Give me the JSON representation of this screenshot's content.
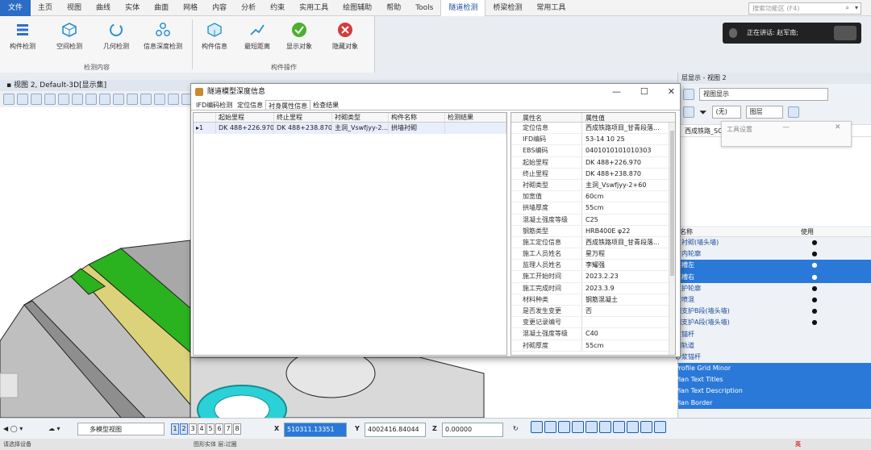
{
  "menu": {
    "items": [
      "文件",
      "主页",
      "视图",
      "曲线",
      "实体",
      "曲面",
      "网格",
      "内容",
      "分析",
      "约束",
      "实用工具",
      "绘图辅助",
      "帮助",
      "Tools",
      "隧道检测",
      "桥梁检测",
      "常用工具"
    ],
    "active_index": 14,
    "search_placeholder": "搜索功能区 (F4)"
  },
  "ribbon": {
    "buttons": [
      "构件检测",
      "空间检测",
      "几何检测",
      "信息深度检测",
      "构件信息",
      "最短距离",
      "显示对象",
      "隐藏对象"
    ],
    "group1_label": "检测内容",
    "group2_label": "构件操作"
  },
  "notification": {
    "text": "正在讲话: 赵军南;"
  },
  "view": {
    "title": "视图 2, Default-3D[显示集]"
  },
  "dialog": {
    "title": "隧道模型深度信息",
    "tabs": [
      "IFD编码检测",
      "定位信息",
      "衬身属性信息",
      "检查结果"
    ],
    "active_tab": 2,
    "left_columns": [
      "起始里程",
      "终止里程",
      "衬砌类型",
      "构件名称",
      "检测结果"
    ],
    "left_row": {
      "index": "1",
      "start": "DK 488+226.970",
      "end": "DK 488+238.870",
      "type": "主洞_Vswfjyy-2...",
      "name": "拱墙衬砌",
      "result": ""
    },
    "right_columns": [
      "属性名",
      "属性值"
    ],
    "properties": [
      [
        "定位信息",
        "西成铁路项目_甘青段落..."
      ],
      [
        "IFD编码",
        "53-14 10 25"
      ],
      [
        "EBS编码",
        "0401010101010303"
      ],
      [
        "起始里程",
        "DK 488+226.970"
      ],
      [
        "终止里程",
        "DK 488+238.870"
      ],
      [
        "衬砌类型",
        "主洞_Vswfjyy-2+60"
      ],
      [
        "加宽值",
        "60cm"
      ],
      [
        "拱墙厚度",
        "55cm"
      ],
      [
        "混凝土强度等级",
        "C25"
      ],
      [
        "钢筋类型",
        "HRB400E φ22"
      ],
      [
        "施工定位信息",
        "西成铁路项目_甘青段落..."
      ],
      [
        "施工人员姓名",
        "星万程"
      ],
      [
        "监理人员姓名",
        "李耀强"
      ],
      [
        "施工开始时间",
        "2023.2.23"
      ],
      [
        "施工完成时间",
        "2023.3.9"
      ],
      [
        "材料种类",
        "钢筋混凝土"
      ],
      [
        "是否发生变更",
        "否"
      ],
      [
        "变更记录编号",
        ""
      ],
      [
        "混凝土强度等级",
        "C40"
      ],
      [
        "衬砌厚度",
        "55cm"
      ]
    ]
  },
  "right_panel": {
    "title": "层显示 - 视图 2",
    "combo1": "视图显示",
    "combo2": "(无)",
    "combo3": "图层",
    "tree_label": "西成铁路_SC",
    "popup_label": "工具设置",
    "list_header_name": "名称",
    "list_header_use": "使用",
    "items": [
      {
        "name": "次衬砌(墙头墙)",
        "sel": false,
        "used": true
      },
      {
        "name": "衬内轮廓",
        "sel": false,
        "used": true
      },
      {
        "name": "隧槽左",
        "sel": true,
        "used": true
      },
      {
        "name": "隧槽右",
        "sel": true,
        "used": true
      },
      {
        "name": "支护轮廓",
        "sel": false,
        "used": true
      },
      {
        "name": "支喷混",
        "sel": false,
        "used": true
      },
      {
        "name": "期支护B段(墙头墙)",
        "sel": false,
        "used": true
      },
      {
        "name": "期支护A段(墙头墙)",
        "sel": false,
        "used": true
      },
      {
        "name": "支锚杆",
        "sel": false,
        "used": false
      },
      {
        "name": "钢轨道",
        "sel": false,
        "used": false
      },
      {
        "name": "砂浆锚杆",
        "sel": false,
        "used": false
      },
      {
        "name": "Profile Grid Minor",
        "sel": true,
        "used": false
      },
      {
        "name": "Plan Text Titles",
        "sel": true,
        "used": false
      },
      {
        "name": "Plan Text Description",
        "sel": true,
        "used": false
      },
      {
        "name": "Plan Border",
        "sel": true,
        "used": false
      }
    ]
  },
  "statusbar": {
    "view_combo": "多模型视图",
    "pages": [
      "1",
      "2",
      "3",
      "4",
      "5",
      "6",
      "7",
      "8"
    ],
    "x_label": "X",
    "x_value": "510311.13351",
    "y_label": "Y",
    "y_value": "4002416.84044",
    "z_label": "Z",
    "z_value": "0.00000"
  },
  "bottom": {
    "left_text": "请选择设备",
    "mid_text": "图形实体 层:过圈",
    "ime": "英"
  },
  "colors": {
    "accent": "#2a79d8",
    "green": "#2bb31f",
    "cyan": "#2ad2d8",
    "yellow": "#d9cf6a"
  }
}
